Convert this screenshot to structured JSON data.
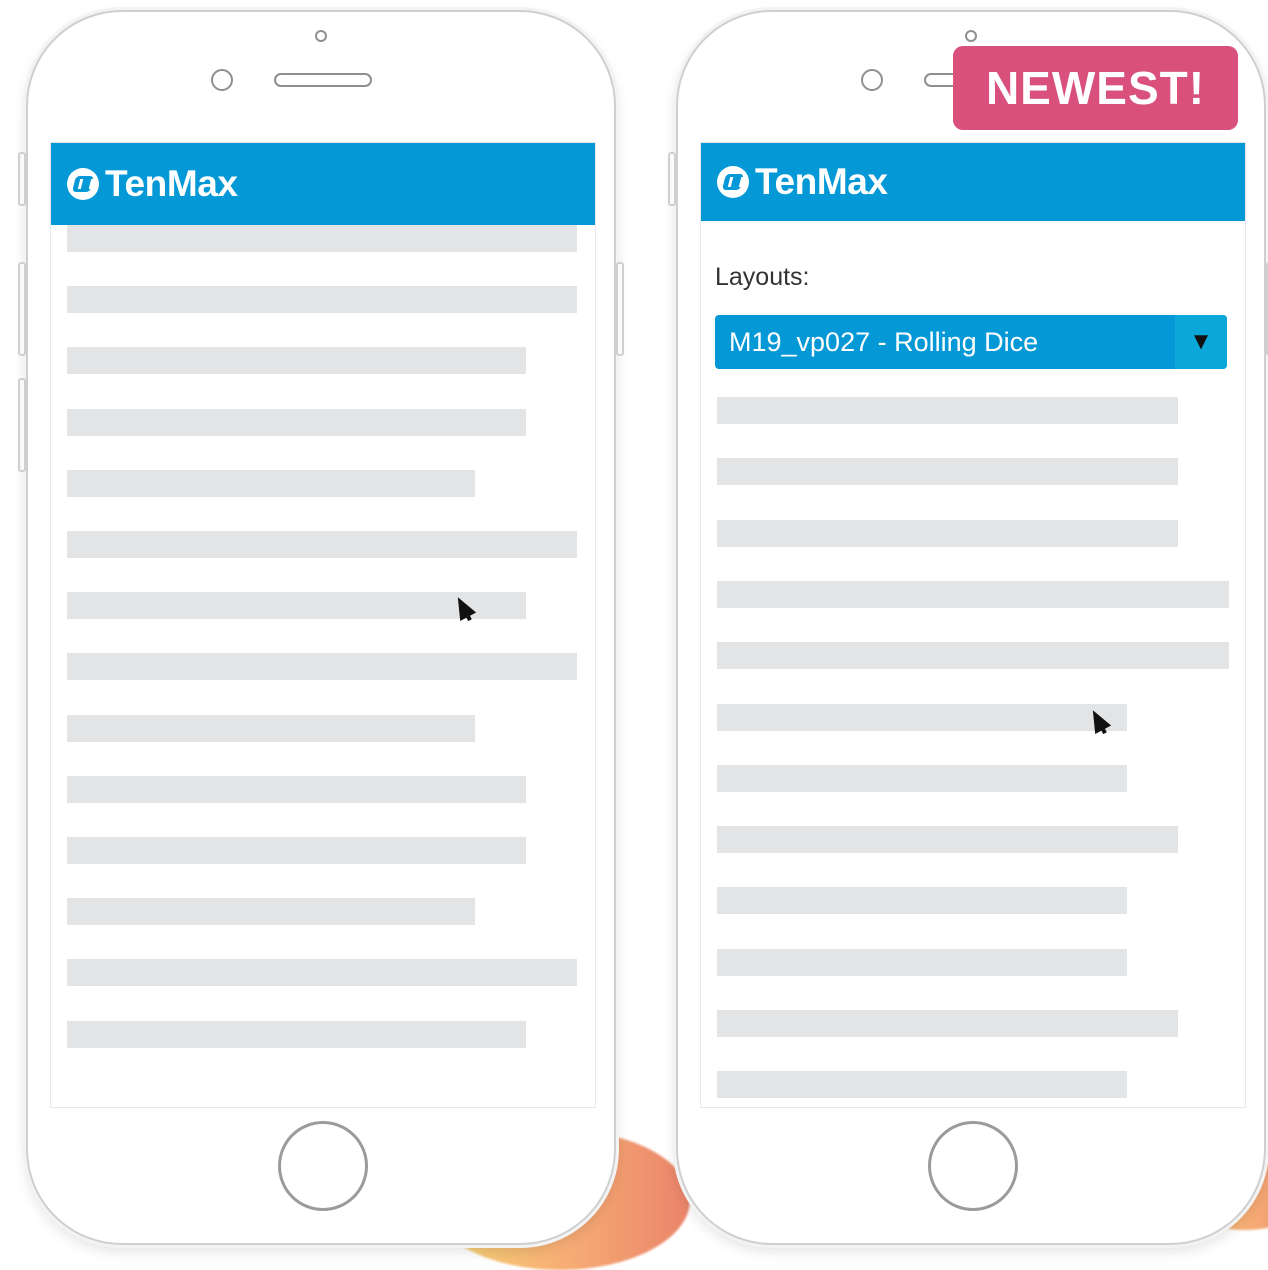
{
  "left_phone": {
    "logo_text": "TenMax",
    "skeleton_rows": [
      {
        "width": 510
      },
      {
        "width": 510
      },
      {
        "width": 459
      },
      {
        "width": 459
      },
      {
        "width": 408
      },
      {
        "width": 510
      },
      {
        "width": 459
      },
      {
        "width": 510
      },
      {
        "width": 408
      },
      {
        "width": 459
      },
      {
        "width": 459
      },
      {
        "width": 408
      },
      {
        "width": 510
      },
      {
        "width": 459
      }
    ]
  },
  "right_phone": {
    "logo_text": "TenMax",
    "layouts_label": "Layouts:",
    "layout_select_value": "M19_vp027 - Rolling Dice",
    "select_arrow": "▼",
    "skeleton_rows": [
      {
        "width": 461
      },
      {
        "width": 461
      },
      {
        "width": 461
      },
      {
        "width": 512
      },
      {
        "width": 512
      },
      {
        "width": 410
      },
      {
        "width": 410
      },
      {
        "width": 461
      },
      {
        "width": 410
      },
      {
        "width": 410
      },
      {
        "width": 461
      },
      {
        "width": 410
      }
    ]
  },
  "badge_text": "NEWEST!",
  "colors": {
    "accent_blue": "#0598d7",
    "badge_pink": "#d8507b",
    "skeleton_gray": "#e3e4e6"
  }
}
